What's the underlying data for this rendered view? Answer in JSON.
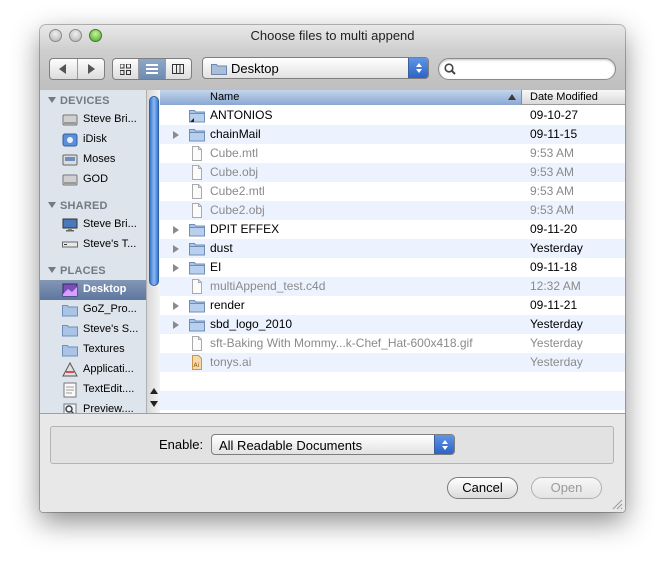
{
  "window": {
    "title": "Choose files to multi append"
  },
  "toolbar": {
    "path_popup": "Desktop",
    "search": {
      "value": "",
      "placeholder": ""
    }
  },
  "sidebar": {
    "sections": [
      {
        "label": "DEVICES",
        "items": [
          {
            "label": "Steve Bri...",
            "icon": "hard-drive-icon"
          },
          {
            "label": "iDisk",
            "icon": "idisk-icon"
          },
          {
            "label": "Moses",
            "icon": "external-drive-icon"
          },
          {
            "label": "GOD",
            "icon": "hard-drive-icon"
          }
        ]
      },
      {
        "label": "SHARED",
        "items": [
          {
            "label": "Steve Bri...",
            "icon": "computer-icon"
          },
          {
            "label": "Steve's T...",
            "icon": "server-icon"
          }
        ]
      },
      {
        "label": "PLACES",
        "items": [
          {
            "label": "Desktop",
            "icon": "desktop-icon",
            "selected": true
          },
          {
            "label": "GoZ_Pro...",
            "icon": "folder-icon"
          },
          {
            "label": "Steve's S...",
            "icon": "folder-icon"
          },
          {
            "label": "Textures",
            "icon": "folder-icon"
          },
          {
            "label": "Applicati...",
            "icon": "applications-icon"
          },
          {
            "label": "TextEdit....",
            "icon": "textedit-icon"
          },
          {
            "label": "Preview....",
            "icon": "preview-icon"
          }
        ]
      }
    ]
  },
  "file_list": {
    "columns": {
      "name": "Name",
      "date": "Date Modified"
    },
    "rows": [
      {
        "name": "ANTONIOS",
        "date": "09-10-27",
        "kind": "alias-folder",
        "enabled": true,
        "expandable": false
      },
      {
        "name": "chainMail",
        "date": "09-11-15",
        "kind": "folder",
        "enabled": true,
        "expandable": true
      },
      {
        "name": "Cube.mtl",
        "date": "9:53 AM",
        "kind": "document",
        "enabled": false,
        "expandable": false
      },
      {
        "name": "Cube.obj",
        "date": "9:53 AM",
        "kind": "document",
        "enabled": false,
        "expandable": false
      },
      {
        "name": "Cube2.mtl",
        "date": "9:53 AM",
        "kind": "document",
        "enabled": false,
        "expandable": false
      },
      {
        "name": "Cube2.obj",
        "date": "9:53 AM",
        "kind": "document",
        "enabled": false,
        "expandable": false
      },
      {
        "name": "DPIT EFFEX",
        "date": "09-11-20",
        "kind": "folder",
        "enabled": true,
        "expandable": true
      },
      {
        "name": "dust",
        "date": "Yesterday",
        "kind": "folder",
        "enabled": true,
        "expandable": true
      },
      {
        "name": "EI",
        "date": "09-11-18",
        "kind": "folder",
        "enabled": true,
        "expandable": true
      },
      {
        "name": "multiAppend_test.c4d",
        "date": "12:32 AM",
        "kind": "document",
        "enabled": false,
        "expandable": false
      },
      {
        "name": "render",
        "date": "09-11-21",
        "kind": "folder",
        "enabled": true,
        "expandable": true
      },
      {
        "name": "sbd_logo_2010",
        "date": "Yesterday",
        "kind": "folder",
        "enabled": true,
        "expandable": true
      },
      {
        "name": "sft-Baking With Mommy...k-Chef_Hat-600x418.gif",
        "date": "Yesterday",
        "kind": "document",
        "enabled": false,
        "expandable": false
      },
      {
        "name": "tonys.ai",
        "date": "Yesterday",
        "kind": "illustrator",
        "enabled": false,
        "expandable": false
      }
    ]
  },
  "footer": {
    "enable_label": "Enable:",
    "enable_value": "All Readable Documents",
    "cancel": "Cancel",
    "open": "Open"
  }
}
